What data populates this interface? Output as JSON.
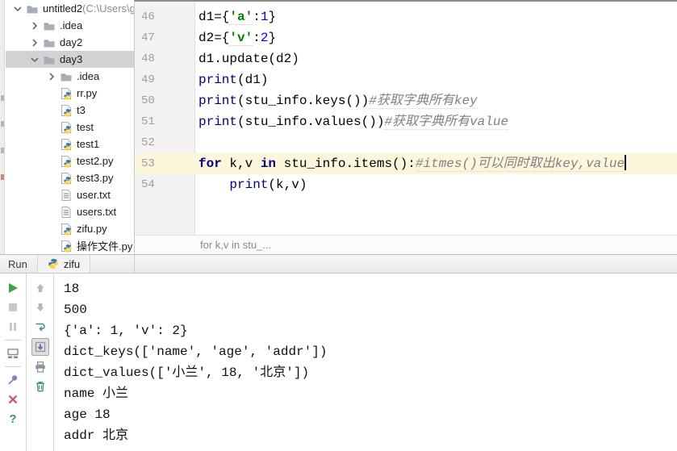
{
  "colors": {
    "keyword": "#000080",
    "string": "#008000",
    "number": "#0000ff",
    "comment": "#808080",
    "line_highlight": "#fcf6dd",
    "tree_selection": "#d2d2d2",
    "gutter_text": "#9e9e9e",
    "run_green": "#3fa342",
    "disabled_gray": "#c9c9c9",
    "close_red": "#d25252",
    "pin_purple": "#9678b6",
    "tool_teal": "#3c8e8e"
  },
  "project_tree": {
    "items": [
      {
        "label": "untitled2",
        "path_suffix": " (C:\\Users\\g",
        "depth": 0,
        "chevron": "down",
        "icon": "folder",
        "selected": false
      },
      {
        "label": ".idea",
        "depth": 1,
        "chevron": "right",
        "icon": "folder",
        "selected": false
      },
      {
        "label": "day2",
        "depth": 1,
        "chevron": "right",
        "icon": "folder",
        "selected": false
      },
      {
        "label": "day3",
        "depth": 1,
        "chevron": "down",
        "icon": "folder",
        "selected": true
      },
      {
        "label": ".idea",
        "depth": 2,
        "chevron": "right",
        "icon": "folder",
        "selected": false
      },
      {
        "label": "rr.py",
        "depth": 2,
        "chevron": "none",
        "icon": "python",
        "selected": false
      },
      {
        "label": "t3",
        "depth": 2,
        "chevron": "none",
        "icon": "python",
        "selected": false
      },
      {
        "label": "test",
        "depth": 2,
        "chevron": "none",
        "icon": "python",
        "selected": false
      },
      {
        "label": "test1",
        "depth": 2,
        "chevron": "none",
        "icon": "python",
        "selected": false
      },
      {
        "label": "test2.py",
        "depth": 2,
        "chevron": "none",
        "icon": "python",
        "selected": false
      },
      {
        "label": "test3.py",
        "depth": 2,
        "chevron": "none",
        "icon": "python",
        "selected": false
      },
      {
        "label": "user.txt",
        "depth": 2,
        "chevron": "none",
        "icon": "text",
        "selected": false
      },
      {
        "label": "users.txt",
        "depth": 2,
        "chevron": "none",
        "icon": "text",
        "selected": false
      },
      {
        "label": "zifu.py",
        "depth": 2,
        "chevron": "none",
        "icon": "python",
        "selected": false
      },
      {
        "label": "操作文件.py",
        "depth": 2,
        "chevron": "none",
        "icon": "python",
        "selected": false
      }
    ]
  },
  "editor": {
    "breadcrumb": "for k,v in stu_...",
    "lines": [
      {
        "num": "46",
        "tokens": [
          {
            "t": "d1={",
            "s": "p"
          },
          {
            "t": "'a'",
            "s": "str"
          },
          {
            "t": ":",
            "s": "p"
          },
          {
            "t": "1",
            "s": "num"
          },
          {
            "t": "}",
            "s": "p"
          }
        ]
      },
      {
        "num": "47",
        "tokens": [
          {
            "t": "d2={",
            "s": "p"
          },
          {
            "t": "'v'",
            "s": "str"
          },
          {
            "t": ":",
            "s": "p"
          },
          {
            "t": "2",
            "s": "num"
          },
          {
            "t": "}",
            "s": "p"
          }
        ]
      },
      {
        "num": "48",
        "tokens": [
          {
            "t": "d1.update(d2)",
            "s": "p"
          }
        ]
      },
      {
        "num": "49",
        "tokens": [
          {
            "t": "print",
            "s": "fn"
          },
          {
            "t": "(d1)",
            "s": "p"
          }
        ]
      },
      {
        "num": "50",
        "tokens": [
          {
            "t": "print",
            "s": "fn"
          },
          {
            "t": "(stu_info.keys())",
            "s": "p"
          },
          {
            "t": "#获取字典所有key",
            "s": "com"
          }
        ]
      },
      {
        "num": "51",
        "tokens": [
          {
            "t": "print",
            "s": "fn"
          },
          {
            "t": "(stu_info.values())",
            "s": "p"
          },
          {
            "t": "#获取字典所有value",
            "s": "com"
          }
        ]
      },
      {
        "num": "52",
        "tokens": []
      },
      {
        "num": "53",
        "highlighted": true,
        "caret": true,
        "tokens": [
          {
            "t": "for",
            "s": "kw"
          },
          {
            "t": " k,v ",
            "s": "p"
          },
          {
            "t": "in",
            "s": "kw"
          },
          {
            "t": " stu_info.items():",
            "s": "p"
          },
          {
            "t": "#itmes()可以同时取出key,value",
            "s": "com"
          }
        ]
      },
      {
        "num": "54",
        "tokens": [
          {
            "t": "    ",
            "s": "p"
          },
          {
            "t": "print",
            "s": "fn"
          },
          {
            "t": "(k,v)",
            "s": "p"
          }
        ]
      }
    ]
  },
  "run_panel": {
    "title": "Run",
    "tab_label": "zifu",
    "tab_icon": "python-logo",
    "toolbar_left": [
      {
        "icon": "rerun"
      },
      {
        "icon": "stop",
        "disabled": true
      },
      {
        "icon": "pause",
        "disabled": true
      },
      {
        "icon": "sep"
      },
      {
        "icon": "restore-layout"
      },
      {
        "icon": "sep"
      },
      {
        "icon": "pin"
      },
      {
        "icon": "close"
      },
      {
        "icon": "help"
      }
    ],
    "toolbar_right": [
      {
        "icon": "up-arrow",
        "disabled": true
      },
      {
        "icon": "down-arrow",
        "disabled": true
      },
      {
        "icon": "soft-wrap"
      },
      {
        "icon": "scroll-to-end",
        "selected": true
      },
      {
        "icon": "print"
      },
      {
        "icon": "clear-all"
      }
    ],
    "output_lines": [
      "18",
      "500",
      "{'a': 1, 'v': 2}",
      "dict_keys(['name', 'age', 'addr'])",
      "dict_values(['小兰', 18, '北京'])",
      "name 小兰",
      "age 18",
      "addr 北京"
    ]
  }
}
